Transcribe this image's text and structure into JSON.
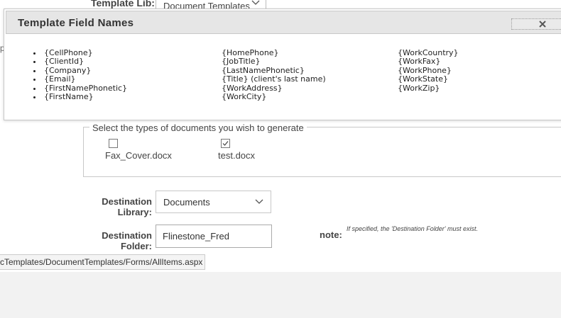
{
  "background": {
    "template_lib_label": "Template Lib:",
    "template_lib_value": "Document Templates",
    "fragment_text": "p"
  },
  "dialog": {
    "title": "Template Field Names",
    "columns": [
      [
        "{CellPhone}",
        "{ClientId}",
        "{Company}",
        "{Email}",
        "{FirstNamePhonetic}",
        "{FirstName}"
      ],
      [
        "{HomePhone}",
        "{JobTitle}",
        "{LastNamePhonetic}",
        "{Title} (client's last name)",
        "{WorkAddress}",
        "{WorkCity}"
      ],
      [
        "{WorkCountry}",
        "{WorkFax}",
        "{WorkPhone}",
        "{WorkState}",
        "{WorkZip}"
      ]
    ]
  },
  "documents": {
    "legend": "Select the types of documents you wish to generate",
    "items": [
      {
        "label": "Fax_Cover.docx",
        "checked": false
      },
      {
        "label": "test.docx",
        "checked": true
      }
    ]
  },
  "destination": {
    "library_label_1": "Destination",
    "library_label_2": "Library:",
    "library_value": "Documents",
    "folder_label_1": "Destination",
    "folder_label_2": "Folder:",
    "folder_value": "Flinestone_Fred",
    "note_label": "note:",
    "note_text": "If specified, the 'Destination Folder' must exist."
  },
  "status_url": "cTemplates/DocumentTemplates/Forms/AllItems.aspx"
}
